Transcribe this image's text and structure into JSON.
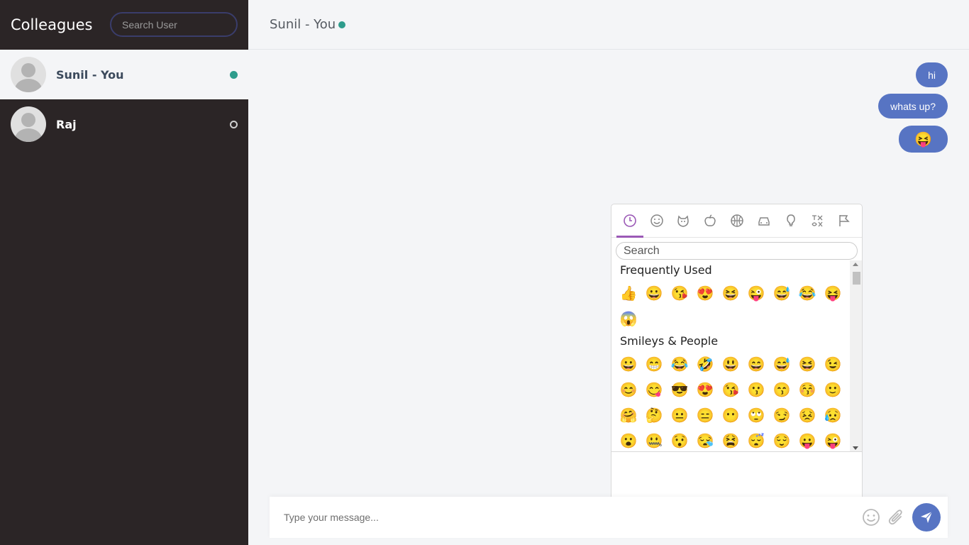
{
  "sidebar": {
    "title": "Colleagues",
    "search_placeholder": "Search User",
    "users": [
      {
        "name": "Sunil - You",
        "status": "online"
      },
      {
        "name": "Raj",
        "status": "offline"
      }
    ]
  },
  "chat": {
    "title": "Sunil - You",
    "messages": [
      {
        "text": "hi"
      },
      {
        "text": "whats up?"
      },
      {
        "text": "😝"
      }
    ]
  },
  "emoji_picker": {
    "categories": [
      "recent-icon",
      "smiley-icon",
      "animal-icon",
      "food-icon",
      "activity-icon",
      "travel-icon",
      "object-icon",
      "symbol-icon",
      "flag-icon"
    ],
    "search_placeholder": "Search",
    "sections": [
      {
        "title": "Frequently Used",
        "emojis": [
          "👍",
          "😀",
          "😘",
          "😍",
          "😆",
          "😜",
          "😅",
          "😂",
          "😝",
          "😱"
        ]
      },
      {
        "title": "Smileys & People",
        "emojis": [
          "😀",
          "😁",
          "😂",
          "🤣",
          "😃",
          "😄",
          "😅",
          "😆",
          "😉",
          "😊",
          "😋",
          "😎",
          "😍",
          "😘",
          "😗",
          "😙",
          "😚",
          "🙂",
          "🤗",
          "🤔",
          "😐",
          "😑",
          "😶",
          "🙄",
          "😏",
          "😣",
          "😥",
          "😮",
          "🤐",
          "😯",
          "😪",
          "😫",
          "😴",
          "😌",
          "😛",
          "😜"
        ]
      }
    ]
  },
  "input": {
    "placeholder": "Type your message..."
  },
  "colors": {
    "accent": "#5774c3",
    "online": "#2e9c8c",
    "sidebar_bg": "#2b2526",
    "picker_accent": "#9b59b6"
  }
}
